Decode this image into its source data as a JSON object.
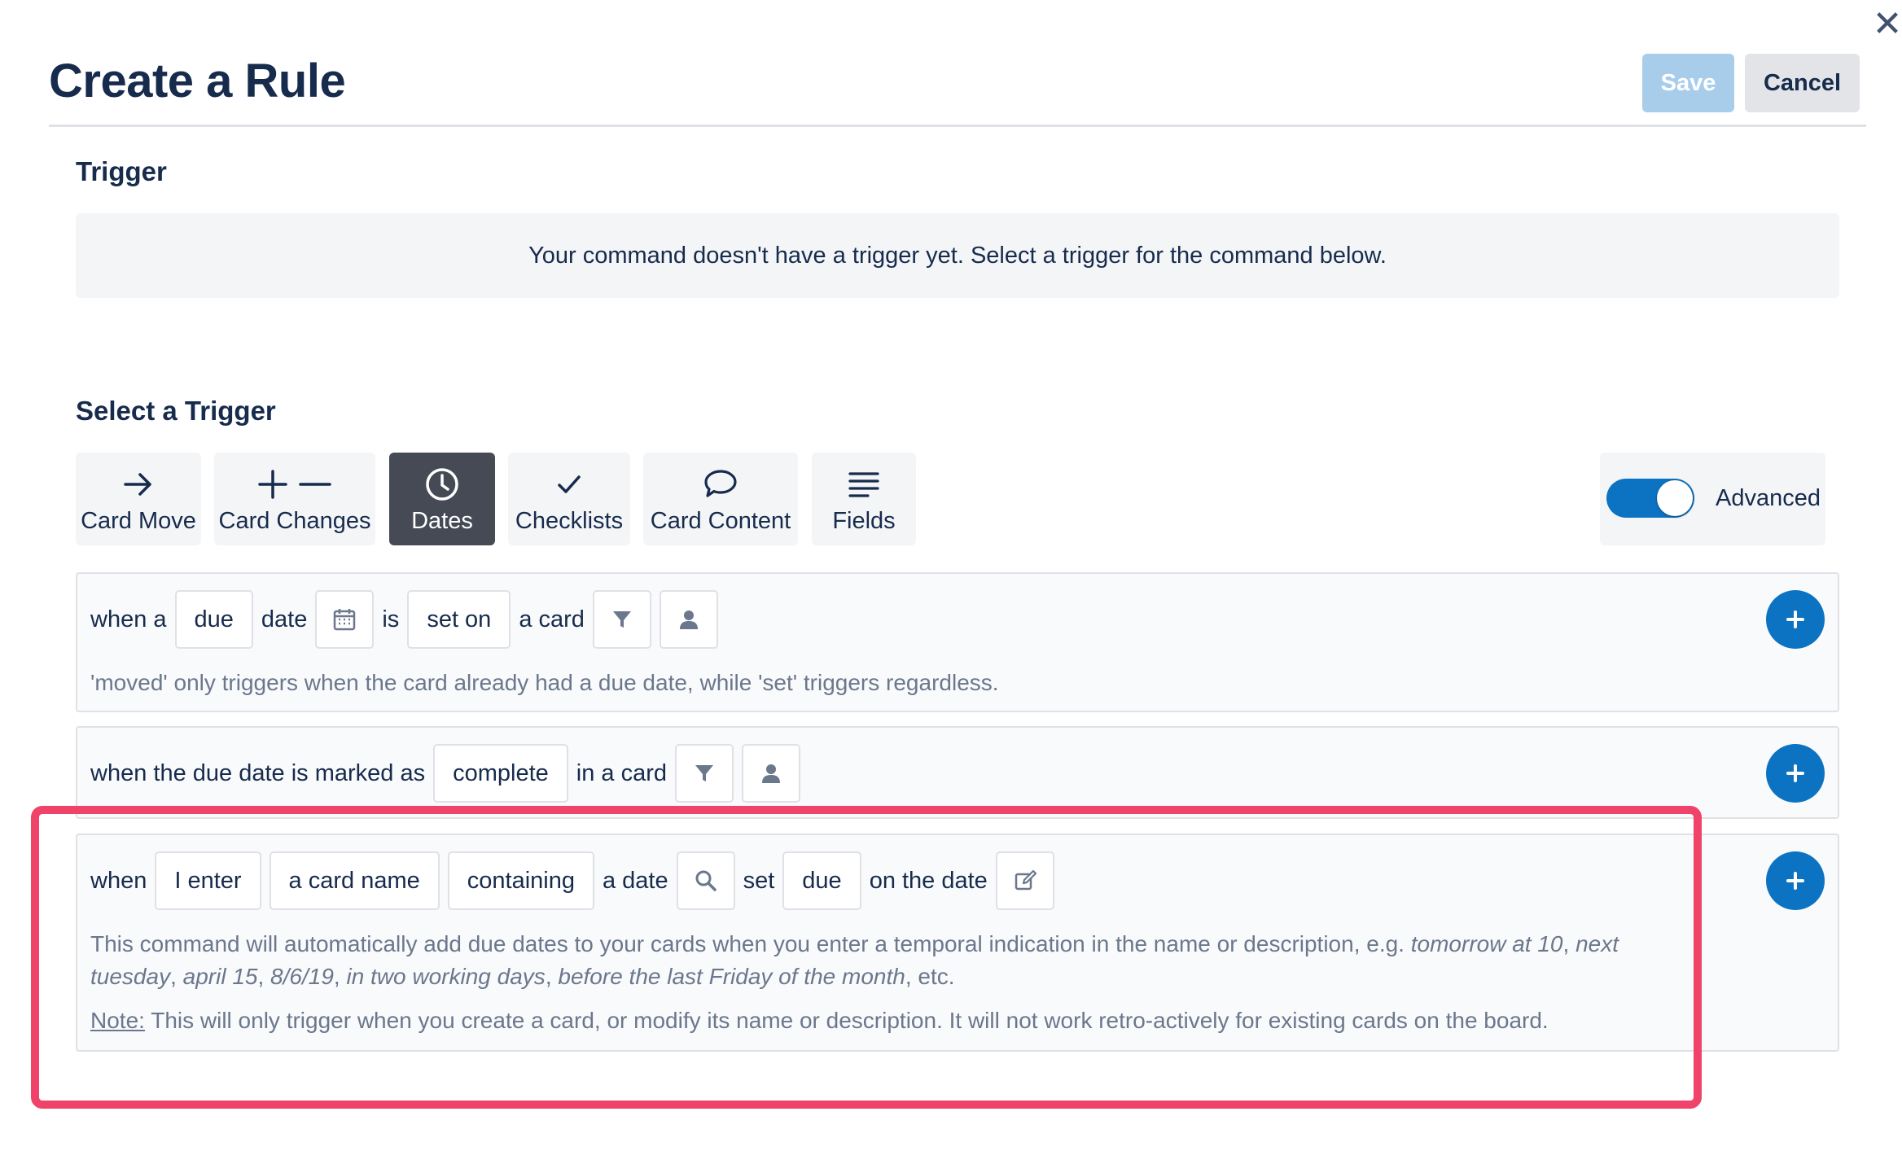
{
  "header": {
    "title": "Create a Rule",
    "save_label": "Save",
    "cancel_label": "Cancel",
    "close_glyph": "✕"
  },
  "trigger": {
    "title": "Trigger",
    "notice": "Your command doesn't have a trigger yet. Select a trigger for the command below."
  },
  "select": {
    "title": "Select a Trigger",
    "tabs": [
      {
        "label": "Card Move",
        "icon": "arrow-right-icon"
      },
      {
        "label": "Card Changes",
        "icon": "plus-minus-icon"
      },
      {
        "label": "Dates",
        "icon": "clock-icon",
        "active": true
      },
      {
        "label": "Checklists",
        "icon": "check-icon"
      },
      {
        "label": "Card Content",
        "icon": "speech-bubble-icon"
      },
      {
        "label": "Fields",
        "icon": "lines-icon"
      }
    ],
    "advanced_label": "Advanced",
    "advanced_on": true
  },
  "card1": {
    "w1": "when a",
    "c1": "due",
    "w2": "date",
    "w3": "is",
    "c2": "set on",
    "w4": "a card",
    "hint": "'moved' only triggers when the card already had a due date, while 'set' triggers regardless."
  },
  "card2": {
    "w1": "when the due date is marked as",
    "c1": "complete",
    "w2": "in a card"
  },
  "card3": {
    "w1": "when",
    "c1": "I enter",
    "c2": "a card name",
    "c3": "containing",
    "w2": "a date",
    "w3": "set",
    "c4": "due",
    "w4": "on the date",
    "hint_prefix": "This command will automatically add due dates to your cards when you enter a temporal indication in the name or description, e.g. ",
    "ex1": "tomorrow at 10",
    "sep1": ", ",
    "ex2": "next tuesday",
    "sep2": ", ",
    "ex3": "april 15",
    "sep3": ", ",
    "ex4": "8/6/19",
    "sep4": ", ",
    "ex5": "in two working days",
    "sep5": ", ",
    "ex6": "before the last Friday of the month",
    "hint_suffix": ", etc.",
    "note_label": "Note:",
    "note_text": " This will only trigger when you create a card, or modify its name or description. It will not work retro-actively for existing cards on the board."
  },
  "colors": {
    "primary": "#0c73c2",
    "highlight": "#f0436a",
    "save_disabled": "#a8cdeb",
    "active_tab": "#454a55"
  }
}
